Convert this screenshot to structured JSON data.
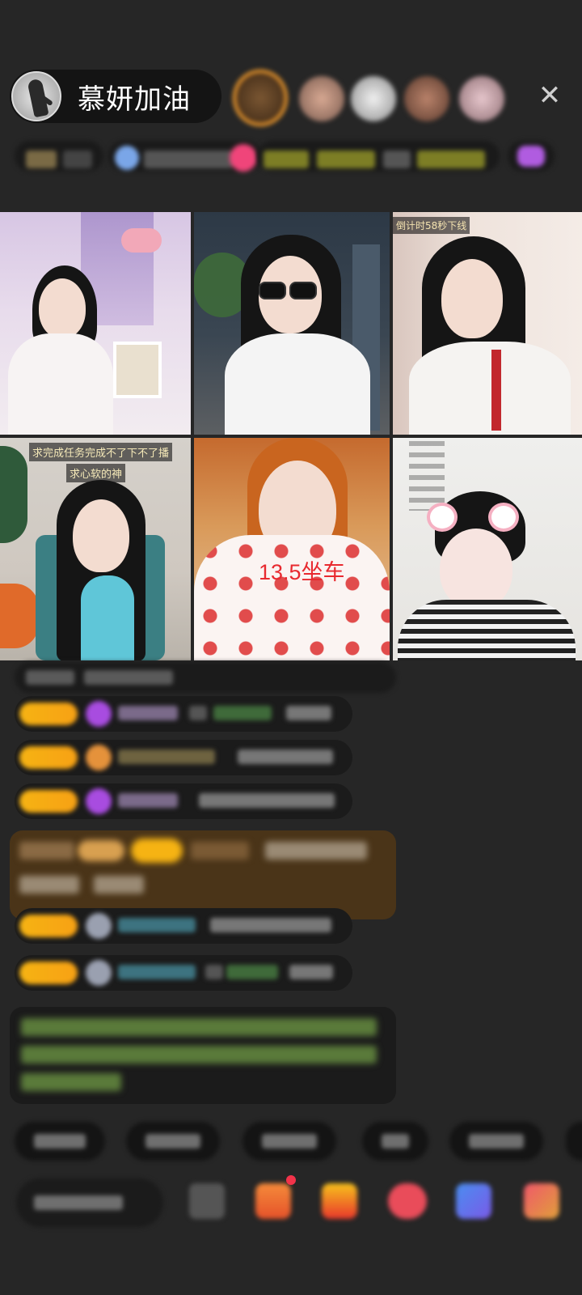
{
  "header": {
    "host_name": "慕妍加油",
    "close_symbol": "✕"
  },
  "video_grid": {
    "tiles": [
      {
        "caption": ""
      },
      {
        "caption": ""
      },
      {
        "caption": "倒计时58秒下线"
      },
      {
        "caption_top": "求完成任务完成不了下不了播",
        "caption_bottom": "求心软的神"
      },
      {
        "overlay": "13.5坐车"
      },
      {
        "caption": ""
      }
    ]
  },
  "colors": {
    "background": "#262626",
    "badge_gold": "#f6b313",
    "overlay_red": "#e8292f",
    "viewer_ring": "#f29b2c"
  },
  "icons": [
    "host-avatar",
    "close-icon",
    "gem-icon",
    "gift-icon",
    "more-icon"
  ]
}
